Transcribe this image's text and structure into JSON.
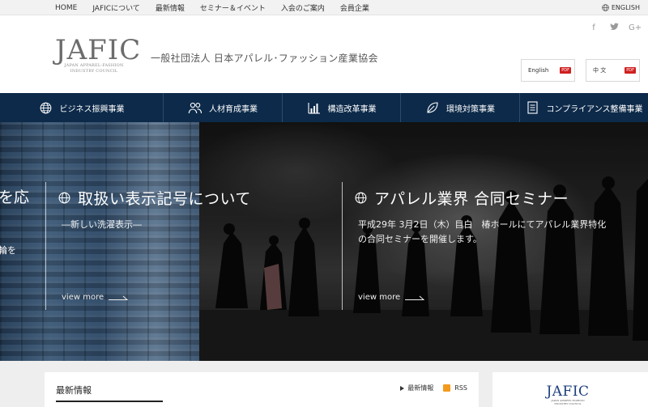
{
  "topnav": {
    "items": [
      "HOME",
      "JAFICについて",
      "最新情報",
      "セミナー＆イベント",
      "入会のご案内",
      "会員企業"
    ],
    "english": "ENGLISH"
  },
  "header": {
    "logo_word": "JAFIC",
    "logo_sub_line1": "JAPAN APPAREL-FASHION",
    "logo_sub_line2": "INDUSTRY COUNCIL",
    "org_name": "一般社団法人 日本アパレル･ファッション産業協会",
    "social": [
      "f",
      "t",
      "G+"
    ],
    "pdf_buttons": [
      {
        "label": "English",
        "badge": "PDF"
      },
      {
        "label": "中 文",
        "badge": "PDF"
      }
    ]
  },
  "mainnav": {
    "items": [
      {
        "label": "ビジネス振興事業",
        "icon": "globe-icon"
      },
      {
        "label": "人材育成事業",
        "icon": "people-icon"
      },
      {
        "label": "構造改革事業",
        "icon": "bar-chart-icon"
      },
      {
        "label": "環境対策事業",
        "icon": "leaf-icon"
      },
      {
        "label": "コンプライアンス整備事業",
        "icon": "document-icon"
      }
    ]
  },
  "hero": {
    "left_partial": {
      "title_fragment": "を応",
      "body_fragment": "輪を"
    },
    "cards": [
      {
        "title": "取扱い表示記号について",
        "body_line1": "―新しい洗濯表示―",
        "body_line2": "",
        "more": "view more"
      },
      {
        "title": "アパレル業界 合同セミナー",
        "body_line1": "平成29年 3月2日（木）目白　椿ホールにてアパレル業界特化",
        "body_line2": "の合同セミナーを開催します。",
        "more": "view more"
      }
    ]
  },
  "news": {
    "title": "最新情報",
    "latest_link": "最新情報",
    "rss_link": "RSS"
  },
  "side": {
    "logo_word": "JAFIC",
    "logo_sub_line1": "JAPAN APPAREL-FASHION",
    "logo_sub_line2": "INDUSTRY COUNCIL"
  },
  "colors": {
    "nav_bg": "#0d2a4a",
    "pdf_badge": "#d11f1f",
    "rss": "#f39a1e"
  }
}
